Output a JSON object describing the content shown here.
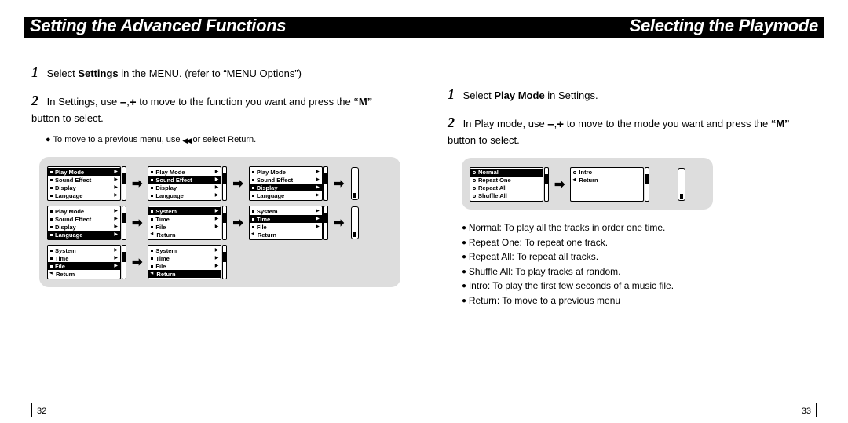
{
  "header": {
    "left_title": "Setting the Advanced Functions",
    "right_title": "Selecting the Playmode"
  },
  "left": {
    "steps": [
      {
        "num": "1",
        "text_a": "Select ",
        "bold": "Settings",
        "text_b": " in the MENU. (refer to “MENU Options”)"
      },
      {
        "num": "2",
        "text_a": "In Settings, use ",
        "text_b": " to move to the function you want and press the ",
        "bold_m": "“M”",
        "text_c": " button to select."
      }
    ],
    "note": "To move to a previous menu, use       or select Return.",
    "menu_basic": [
      "Play Mode",
      "Sound Effect",
      "Display",
      "Language"
    ],
    "menu_system": [
      "System",
      "Time",
      "File",
      "Return"
    ]
  },
  "right": {
    "steps": [
      {
        "num": "1",
        "text_a": "Select ",
        "bold": "Play Mode",
        "text_b": " in Settings."
      },
      {
        "num": "2",
        "text_a": "In Play mode, use ",
        "text_b": " to move to the mode you want and press the ",
        "bold_m": "“M”",
        "text_c": " button to select."
      }
    ],
    "menu_modes_a": [
      "Normal",
      "Repeat One",
      "Repeat All",
      "Shuffle All"
    ],
    "menu_modes_b": [
      "Intro",
      "Return"
    ],
    "descriptions": [
      "Normal: To play all the tracks in order one time.",
      "Repeat One: To repeat one track.",
      "Repeat All: To repeat all tracks.",
      "Shuffle All: To play tracks at random.",
      "Intro: To play the first few seconds of a music file.",
      "Return: To move to a previous menu"
    ]
  },
  "pages": {
    "left": "32",
    "right": "33"
  }
}
